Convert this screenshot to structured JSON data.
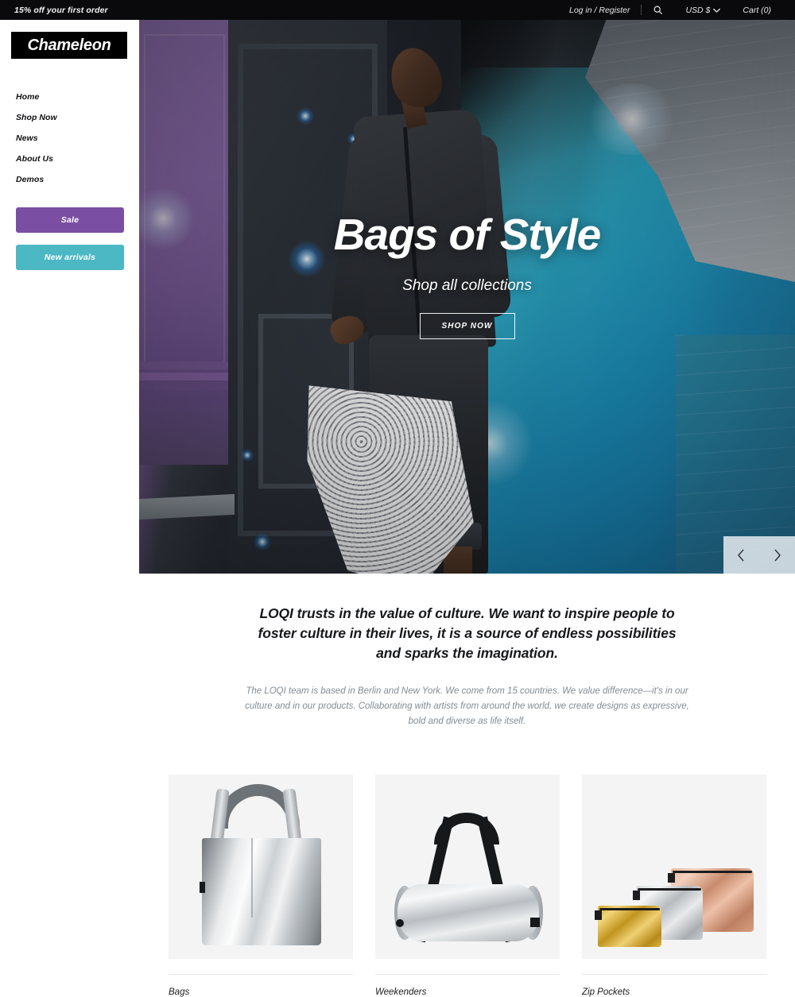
{
  "topbar": {
    "promo": "15% off your first order",
    "login": "Log in / Register",
    "search_icon": "search-icon",
    "currency": "USD $",
    "currency_chevron": "chevron-down-icon",
    "cart": "Cart (0)"
  },
  "sidebar": {
    "logo": "Chameleon",
    "nav": [
      {
        "label": "Home"
      },
      {
        "label": "Shop Now"
      },
      {
        "label": "News"
      },
      {
        "label": "About Us"
      },
      {
        "label": "Demos"
      }
    ],
    "buttons": [
      {
        "label": "Sale",
        "color": "#7a4fa3"
      },
      {
        "label": "New arrivals",
        "color": "#4cb8c4"
      }
    ]
  },
  "hero": {
    "title": "Bags of Style",
    "subtitle": "Shop all collections",
    "cta": "SHOP NOW",
    "prev_icon": "chevron-left-icon",
    "next_icon": "chevron-right-icon"
  },
  "intro": {
    "heading": "LOQI trusts in the value of culture. We want to inspire people to foster culture in their lives, it is a source of endless possibilities and sparks the imagination.",
    "body": "The LOQI team is based in Berlin and New York. We come from 15 countries. We value difference—it's in our culture and in our products. Collaborating with artists from around the world, we create designs as expressive, bold and diverse as life itself."
  },
  "products": [
    {
      "title": "Bags"
    },
    {
      "title": "Weekenders"
    },
    {
      "title": "Zip Pockets"
    }
  ],
  "colors": {
    "topbar_bg": "#0a0a0c",
    "sale_button": "#7a4fa3",
    "new_arrivals_button": "#4cb8c4",
    "text_primary": "#17181b",
    "text_muted": "#838b93",
    "product_bg": "#f4f4f4"
  }
}
